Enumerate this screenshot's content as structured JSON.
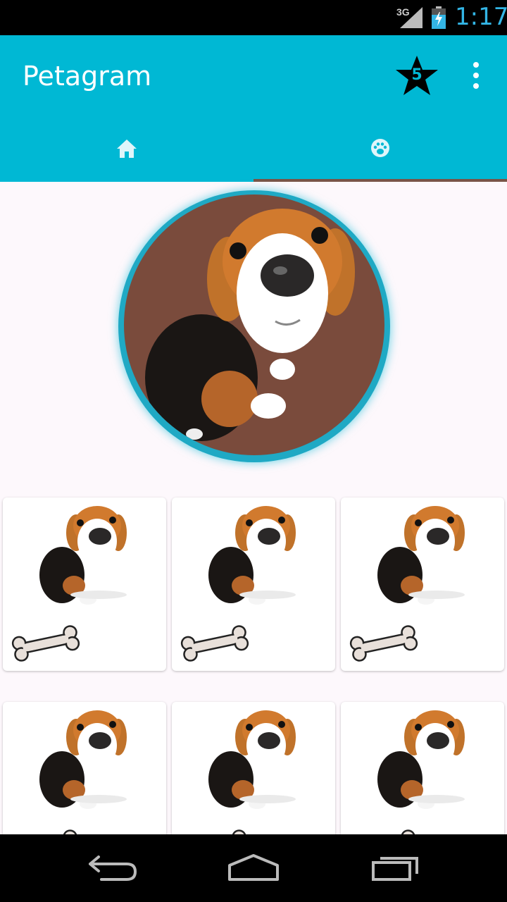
{
  "status_bar": {
    "network": "3G",
    "time": "1:17"
  },
  "app_bar": {
    "title": "Petagram",
    "rating_badge": "5",
    "overflow_icon": "more-vert-icon"
  },
  "tabs": [
    {
      "icon": "home-icon",
      "selected": false
    },
    {
      "icon": "paw-icon",
      "selected": true
    }
  ],
  "profile": {
    "image": "beagle-puppy-photo"
  },
  "pet_cards": [
    {
      "image": "beagle-puppy",
      "icon": "bone-icon"
    },
    {
      "image": "beagle-puppy",
      "icon": "bone-icon"
    },
    {
      "image": "beagle-puppy",
      "icon": "bone-icon"
    },
    {
      "image": "beagle-puppy",
      "icon": "bone-icon"
    },
    {
      "image": "beagle-puppy",
      "icon": "bone-icon"
    },
    {
      "image": "beagle-puppy",
      "icon": "bone-icon"
    }
  ],
  "nav_bar": {
    "buttons": [
      "back-icon",
      "home-icon",
      "recents-icon"
    ]
  },
  "colors": {
    "primary": "#00b8d4",
    "accent": "#795548",
    "status_time": "#33b5e5"
  }
}
